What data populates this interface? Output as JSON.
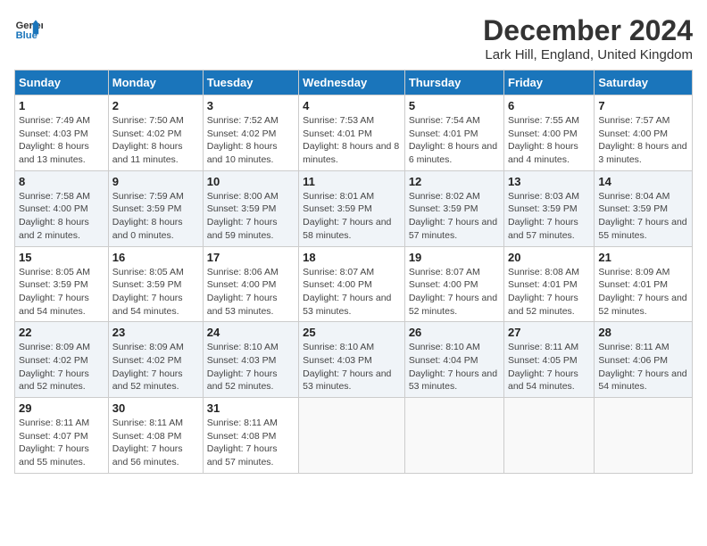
{
  "header": {
    "logo_line1": "General",
    "logo_line2": "Blue",
    "month_title": "December 2024",
    "location": "Lark Hill, England, United Kingdom"
  },
  "weekdays": [
    "Sunday",
    "Monday",
    "Tuesday",
    "Wednesday",
    "Thursday",
    "Friday",
    "Saturday"
  ],
  "weeks": [
    [
      {
        "day": "1",
        "sunrise": "7:49 AM",
        "sunset": "4:03 PM",
        "daylight": "8 hours and 13 minutes."
      },
      {
        "day": "2",
        "sunrise": "7:50 AM",
        "sunset": "4:02 PM",
        "daylight": "8 hours and 11 minutes."
      },
      {
        "day": "3",
        "sunrise": "7:52 AM",
        "sunset": "4:02 PM",
        "daylight": "8 hours and 10 minutes."
      },
      {
        "day": "4",
        "sunrise": "7:53 AM",
        "sunset": "4:01 PM",
        "daylight": "8 hours and 8 minutes."
      },
      {
        "day": "5",
        "sunrise": "7:54 AM",
        "sunset": "4:01 PM",
        "daylight": "8 hours and 6 minutes."
      },
      {
        "day": "6",
        "sunrise": "7:55 AM",
        "sunset": "4:00 PM",
        "daylight": "8 hours and 4 minutes."
      },
      {
        "day": "7",
        "sunrise": "7:57 AM",
        "sunset": "4:00 PM",
        "daylight": "8 hours and 3 minutes."
      }
    ],
    [
      {
        "day": "8",
        "sunrise": "7:58 AM",
        "sunset": "4:00 PM",
        "daylight": "8 hours and 2 minutes."
      },
      {
        "day": "9",
        "sunrise": "7:59 AM",
        "sunset": "3:59 PM",
        "daylight": "8 hours and 0 minutes."
      },
      {
        "day": "10",
        "sunrise": "8:00 AM",
        "sunset": "3:59 PM",
        "daylight": "7 hours and 59 minutes."
      },
      {
        "day": "11",
        "sunrise": "8:01 AM",
        "sunset": "3:59 PM",
        "daylight": "7 hours and 58 minutes."
      },
      {
        "day": "12",
        "sunrise": "8:02 AM",
        "sunset": "3:59 PM",
        "daylight": "7 hours and 57 minutes."
      },
      {
        "day": "13",
        "sunrise": "8:03 AM",
        "sunset": "3:59 PM",
        "daylight": "7 hours and 57 minutes."
      },
      {
        "day": "14",
        "sunrise": "8:04 AM",
        "sunset": "3:59 PM",
        "daylight": "7 hours and 55 minutes."
      }
    ],
    [
      {
        "day": "15",
        "sunrise": "8:05 AM",
        "sunset": "3:59 PM",
        "daylight": "7 hours and 54 minutes."
      },
      {
        "day": "16",
        "sunrise": "8:05 AM",
        "sunset": "3:59 PM",
        "daylight": "7 hours and 54 minutes."
      },
      {
        "day": "17",
        "sunrise": "8:06 AM",
        "sunset": "4:00 PM",
        "daylight": "7 hours and 53 minutes."
      },
      {
        "day": "18",
        "sunrise": "8:07 AM",
        "sunset": "4:00 PM",
        "daylight": "7 hours and 53 minutes."
      },
      {
        "day": "19",
        "sunrise": "8:07 AM",
        "sunset": "4:00 PM",
        "daylight": "7 hours and 52 minutes."
      },
      {
        "day": "20",
        "sunrise": "8:08 AM",
        "sunset": "4:01 PM",
        "daylight": "7 hours and 52 minutes."
      },
      {
        "day": "21",
        "sunrise": "8:09 AM",
        "sunset": "4:01 PM",
        "daylight": "7 hours and 52 minutes."
      }
    ],
    [
      {
        "day": "22",
        "sunrise": "8:09 AM",
        "sunset": "4:02 PM",
        "daylight": "7 hours and 52 minutes."
      },
      {
        "day": "23",
        "sunrise": "8:09 AM",
        "sunset": "4:02 PM",
        "daylight": "7 hours and 52 minutes."
      },
      {
        "day": "24",
        "sunrise": "8:10 AM",
        "sunset": "4:03 PM",
        "daylight": "7 hours and 52 minutes."
      },
      {
        "day": "25",
        "sunrise": "8:10 AM",
        "sunset": "4:03 PM",
        "daylight": "7 hours and 53 minutes."
      },
      {
        "day": "26",
        "sunrise": "8:10 AM",
        "sunset": "4:04 PM",
        "daylight": "7 hours and 53 minutes."
      },
      {
        "day": "27",
        "sunrise": "8:11 AM",
        "sunset": "4:05 PM",
        "daylight": "7 hours and 54 minutes."
      },
      {
        "day": "28",
        "sunrise": "8:11 AM",
        "sunset": "4:06 PM",
        "daylight": "7 hours and 54 minutes."
      }
    ],
    [
      {
        "day": "29",
        "sunrise": "8:11 AM",
        "sunset": "4:07 PM",
        "daylight": "7 hours and 55 minutes."
      },
      {
        "day": "30",
        "sunrise": "8:11 AM",
        "sunset": "4:08 PM",
        "daylight": "7 hours and 56 minutes."
      },
      {
        "day": "31",
        "sunrise": "8:11 AM",
        "sunset": "4:08 PM",
        "daylight": "7 hours and 57 minutes."
      },
      null,
      null,
      null,
      null
    ]
  ]
}
